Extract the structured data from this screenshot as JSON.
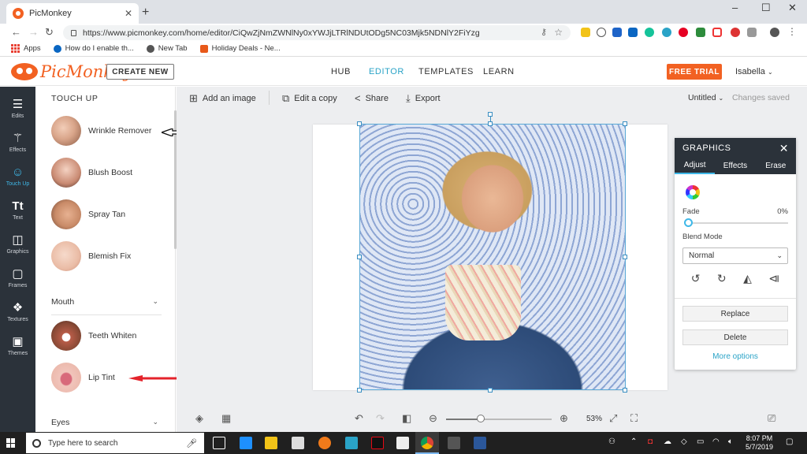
{
  "browser": {
    "tab_title": "PicMonkey",
    "tab_close": "✕",
    "new_tab": "+",
    "url": "https://www.picmonkey.com/home/editor/CiQwZjNmZWNlNy0xYWJjLTRlNDUtODg5NC03Mjk5NDNlY2FiYzg",
    "window_controls": [
      "–",
      "☐",
      "✕"
    ],
    "bookmarks": [
      {
        "label": "Apps",
        "icon": "apps-grid-icon"
      },
      {
        "label": "How do I enable th...",
        "icon": "linkedin-icon",
        "color": "#0a66c2"
      },
      {
        "label": "New Tab",
        "icon": "globe-icon",
        "color": "#555555"
      },
      {
        "label": "Holiday Deals - Ne...",
        "icon": "holiday-deals-icon",
        "color": "#e8591a"
      }
    ]
  },
  "header": {
    "logo_text": "PicMonkey",
    "create_new": "CREATE NEW",
    "nav": [
      "HUB",
      "EDITOR",
      "TEMPLATES",
      "LEARN"
    ],
    "active_nav": "EDITOR",
    "free_trial": "FREE TRIAL",
    "user": "Isabella",
    "accent": "#f26122",
    "link_color": "#2aa3c7"
  },
  "leftbar": {
    "items": [
      {
        "label": "Edits",
        "icon": "sliders-icon"
      },
      {
        "label": "Effects",
        "icon": "magic-wand-icon"
      },
      {
        "label": "Touch Up",
        "icon": "face-icon"
      },
      {
        "label": "Text",
        "icon": "text-icon"
      },
      {
        "label": "Graphics",
        "icon": "shapes-icon"
      },
      {
        "label": "Frames",
        "icon": "frame-icon"
      },
      {
        "label": "Textures",
        "icon": "texture-icon"
      },
      {
        "label": "Themes",
        "icon": "themes-icon"
      }
    ],
    "active": "Touch Up"
  },
  "panel": {
    "title": "TOUCH UP",
    "items": [
      "Wrinkle Remover",
      "Blush Boost",
      "Spray Tan",
      "Blemish Fix"
    ],
    "sections": [
      {
        "title": "Mouth",
        "items": [
          "Teeth Whiten",
          "Lip Tint"
        ]
      },
      {
        "title": "Eyes",
        "items": []
      }
    ]
  },
  "workspace": {
    "toolbar": {
      "add_image": "Add an image",
      "edit_copy": "Edit a copy",
      "share": "Share",
      "export": "Export",
      "doc_title": "Untitled",
      "save_status": "Changes saved"
    },
    "zoom": "53%",
    "zoom_fraction": 0.33
  },
  "graphics_palette": {
    "title": "GRAPHICS",
    "tabs": [
      "Adjust",
      "Effects",
      "Erase"
    ],
    "active_tab": "Adjust",
    "fade_label": "Fade",
    "fade_value": "0%",
    "blend_label": "Blend Mode",
    "blend_value": "Normal",
    "replace": "Replace",
    "delete": "Delete",
    "more_options": "More options"
  },
  "taskbar": {
    "search_placeholder": "Type here to search",
    "time": "8:07 PM",
    "date": "5/7/2019"
  }
}
